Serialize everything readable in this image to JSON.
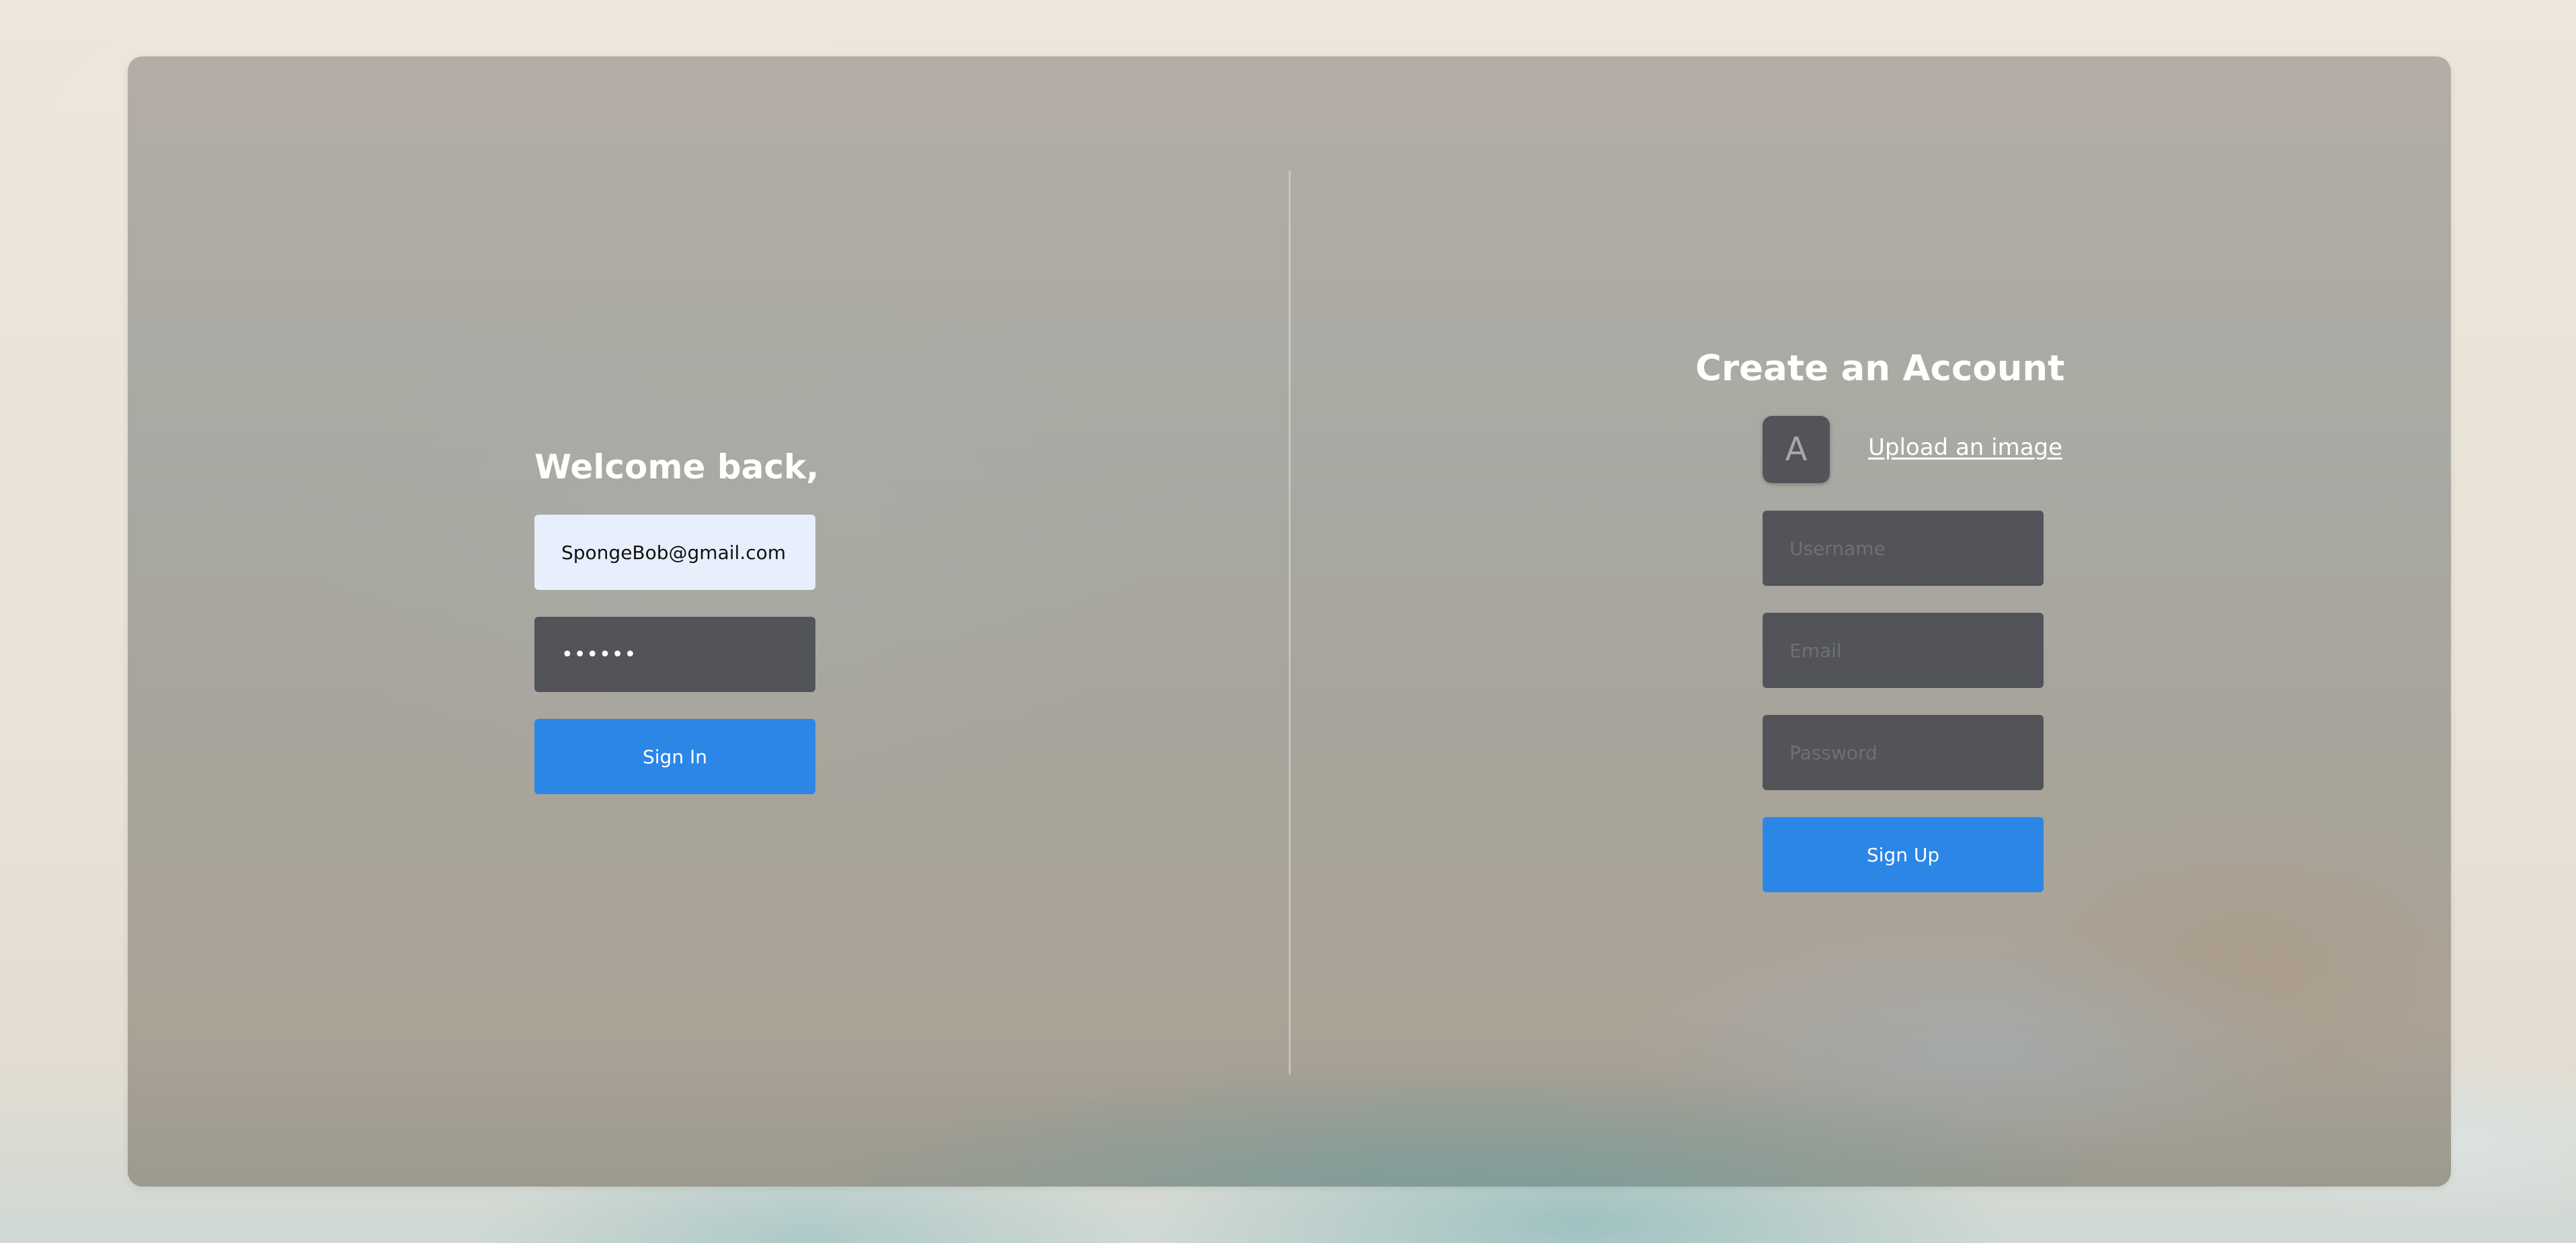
{
  "sign_in": {
    "heading": "Welcome back,",
    "email_value": "SpongeBob@gmail.com",
    "password_value": "••••••",
    "submit_label": "Sign In"
  },
  "sign_up": {
    "heading": "Create an Account",
    "avatar_letter": "A",
    "upload_label": "Upload an image",
    "username_placeholder": "Username",
    "email_placeholder": "Email",
    "password_placeholder": "Password",
    "submit_label": "Sign Up"
  },
  "colors": {
    "primary_button": "#2c86e6",
    "dark_field": "#52545a",
    "light_field": "#e8effc"
  }
}
